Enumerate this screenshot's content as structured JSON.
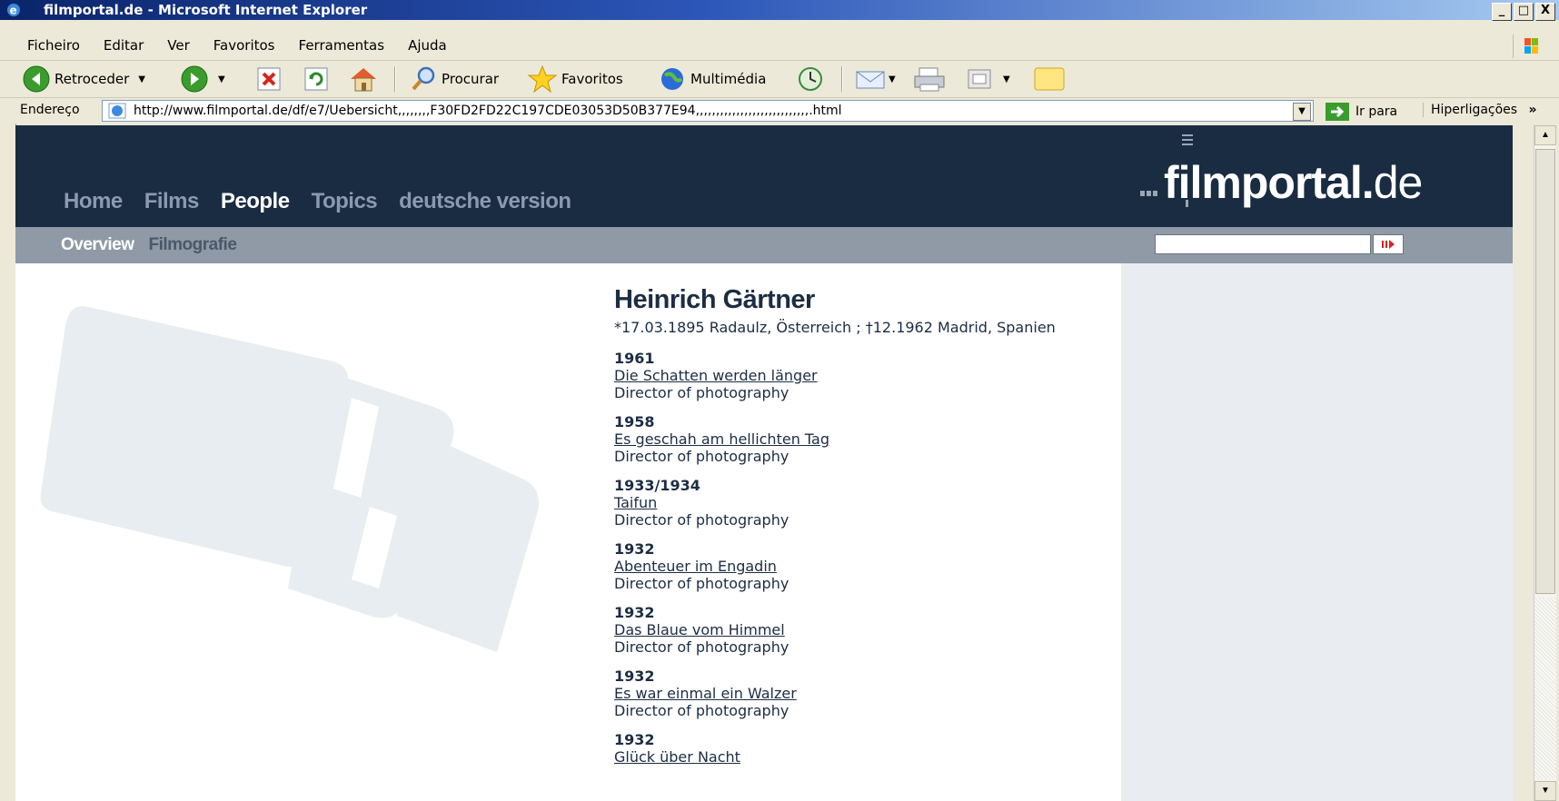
{
  "window": {
    "title": "filmportal.de - Microsoft Internet Explorer",
    "controls": {
      "minimize": "_",
      "maximize": "□",
      "close": "X"
    }
  },
  "menu": [
    "Ficheiro",
    "Editar",
    "Ver",
    "Favoritos",
    "Ferramentas",
    "Ajuda"
  ],
  "toolbar": {
    "back": "Retroceder",
    "search": "Procurar",
    "favorites": "Favoritos",
    "media": "Multimédia"
  },
  "address": {
    "label": "Endereço",
    "url": "http://www.filmportal.de/df/e7/Uebersicht,,,,,,,,F30FD2FD22C197CDE03053D50B377E94,,,,,,,,,,,,,,,,,,,,,,,,,,,,.html",
    "go": "Ir para",
    "links": "Hiperligações"
  },
  "site": {
    "logo_main": "filmportal.",
    "logo_tld": "de",
    "nav": [
      {
        "label": "Home",
        "active": false
      },
      {
        "label": "Films",
        "active": false
      },
      {
        "label": "People",
        "active": true
      },
      {
        "label": "Topics",
        "active": false
      },
      {
        "label": "deutsche version",
        "active": false
      }
    ],
    "subnav": [
      {
        "label": "Overview",
        "active": true
      },
      {
        "label": "Filmografie",
        "active": false
      }
    ],
    "search_placeholder": ""
  },
  "person": {
    "name": "Heinrich Gärtner",
    "bio": "*17.03.1895 Radaulz, Österreich ; †12.1962 Madrid, Spanien",
    "filmography": [
      {
        "year": "1961",
        "title": "Die Schatten werden länger",
        "role": "Director of photography"
      },
      {
        "year": "1958",
        "title": "Es geschah am hellichten Tag",
        "role": "Director of photography"
      },
      {
        "year": "1933/1934",
        "title": "Taifun",
        "role": "Director of photography"
      },
      {
        "year": "1932",
        "title": "Abenteuer im Engadin",
        "role": "Director of photography"
      },
      {
        "year": "1932",
        "title": "Das Blaue vom Himmel",
        "role": "Director of photography"
      },
      {
        "year": "1932",
        "title": "Es war einmal ein Walzer",
        "role": "Director of photography"
      },
      {
        "year": "1932",
        "title": "Glück über Nacht",
        "role": ""
      }
    ]
  },
  "colors": {
    "header": "#192c42",
    "subbar": "#8f9aa6",
    "text": "#1c2d44",
    "sidebar": "#e9edf1"
  }
}
